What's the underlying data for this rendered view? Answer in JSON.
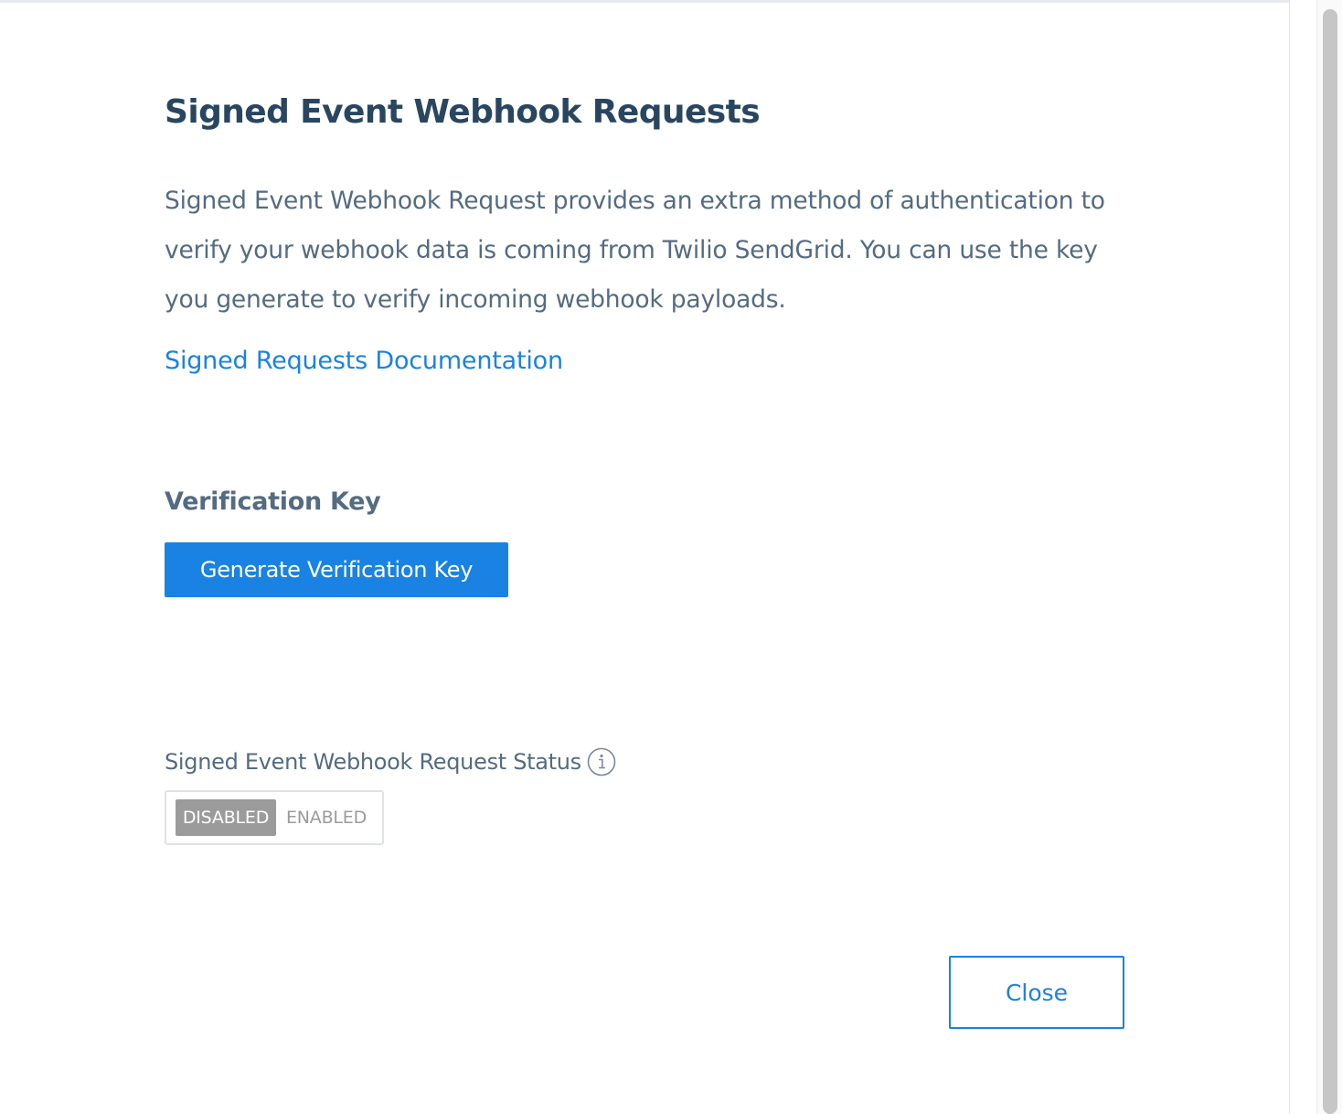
{
  "modal": {
    "title": "Signed Event Webhook Requests",
    "description": "Signed Event Webhook Request provides an extra method of authentication to verify your webhook data is coming from Twilio SendGrid. You can use the key you generate to verify incoming webhook payloads.",
    "doc_link": "Signed Requests Documentation",
    "verification_heading": "Verification Key",
    "generate_button": "Generate Verification Key",
    "status_label": "Signed Event Webhook Request Status",
    "status_icon": "info-icon",
    "toggle": {
      "selected": "DISABLED",
      "options": [
        "DISABLED",
        "ENABLED"
      ]
    },
    "close_button": "Close"
  },
  "colors": {
    "title": "#294661",
    "body_text": "#546b81",
    "accent": "#1a82e2",
    "toggle_active_bg": "#9b9b9b",
    "toggle_inactive_text": "#9b9b9b"
  }
}
